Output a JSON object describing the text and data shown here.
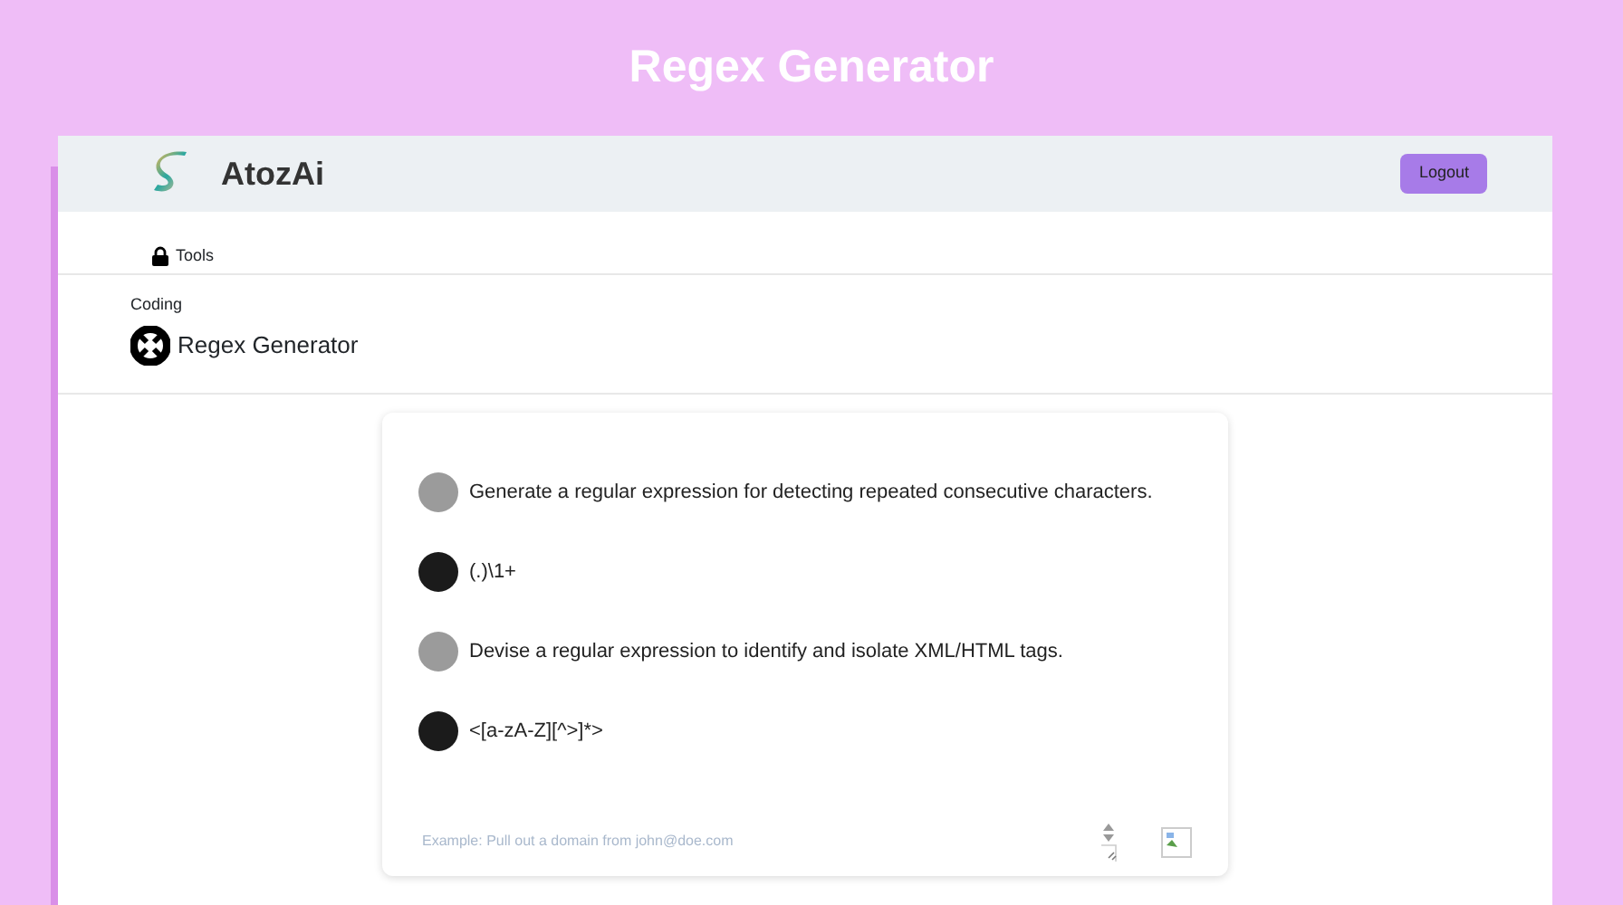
{
  "page_title": "Regex Generator",
  "navbar": {
    "brand": "AtozAi",
    "logout": "Logout"
  },
  "nav": {
    "tools": "Tools"
  },
  "tool": {
    "category": "Coding",
    "name": "Regex Generator"
  },
  "messages": [
    {
      "kind": "user",
      "text": "Generate a regular expression for detecting repeated consecutive characters."
    },
    {
      "kind": "bot",
      "text": "(.)\\1+"
    },
    {
      "kind": "user",
      "text": "Devise a regular expression to identify and isolate XML/HTML tags."
    },
    {
      "kind": "bot",
      "text": "<[a-zA-Z][^>]*>"
    }
  ],
  "input": {
    "placeholder": "Example: Pull out a domain from john@doe.com"
  }
}
